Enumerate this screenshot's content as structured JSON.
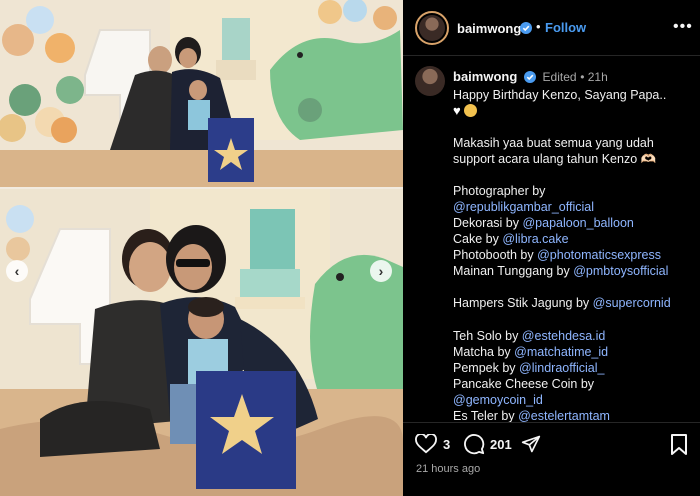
{
  "post": {
    "username": "baimwong",
    "follow_label": "Follow",
    "header_dot": "•",
    "edited_label": "Edited",
    "age_short": "21h",
    "timestamp": "21 hours ago"
  },
  "caption": {
    "line1": "Happy Birthday Kenzo, Sayang Papa..",
    "line3": "Makasih yaa buat semua yang udah",
    "line4": "support acara ulang tahun Kenzo 🫶🏻",
    "credits": [
      {
        "label": "Photographer by",
        "handle": "@republikgambar_official",
        "split": true
      },
      {
        "label": "Dekorasi by ",
        "handle": "@papaloon_balloon"
      },
      {
        "label": "Cake by ",
        "handle": "@libra.cake"
      },
      {
        "label": "Photobooth by ",
        "handle": "@photomaticsexpress"
      },
      {
        "label": "Mainan Tunggang by ",
        "handle": "@pmbtoysofficial"
      },
      {
        "label": "Hampers Stik Jagung by ",
        "handle": "@supercornid"
      },
      {
        "label": "Teh Solo by ",
        "handle": "@estehdesa.id"
      },
      {
        "label": "Matcha by ",
        "handle": "@matchatime_id"
      },
      {
        "label": "Pempek by ",
        "handle": "@lindraofficial_"
      },
      {
        "label": "Pancake Cheese Coin by",
        "handle": "@gemoycoin_id",
        "split": true
      },
      {
        "label": "Es Teler by ",
        "handle": "@estelertamtam"
      }
    ]
  },
  "stats": {
    "likes": "3",
    "comments": "201"
  },
  "icons": {
    "heart": "heart-icon",
    "comment": "comment-icon",
    "share": "share-icon",
    "save": "bookmark-icon",
    "verified": "verified-badge-icon",
    "more": "more-options-icon"
  },
  "colors": {
    "accent": "#4a9bf0",
    "mention": "#8fb6ff",
    "background": "#000000"
  }
}
